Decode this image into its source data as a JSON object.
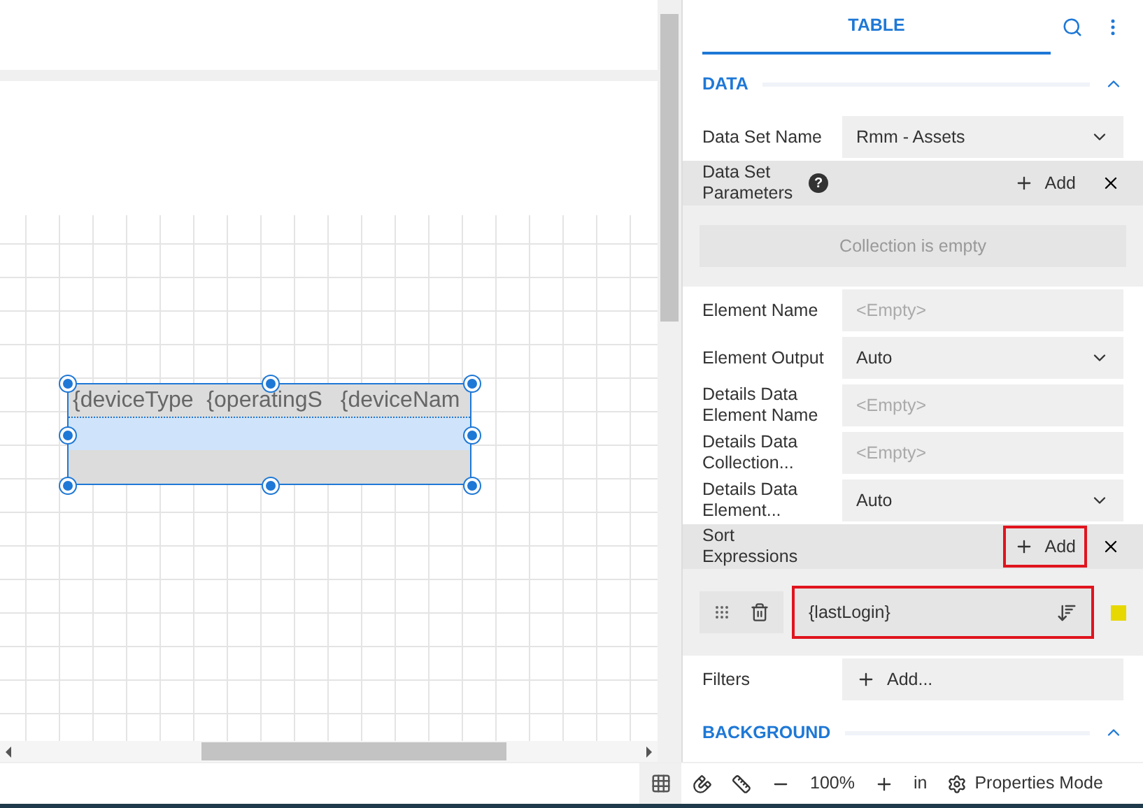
{
  "canvas": {
    "table_element": {
      "header_cells": [
        "{deviceType",
        "{operatingS",
        "{deviceNam"
      ],
      "selected": true
    }
  },
  "panel": {
    "tabs": [
      {
        "label": "TABLE",
        "selected": true
      }
    ],
    "sections": [
      {
        "title": "DATA",
        "expanded": true,
        "rows": [
          {
            "kind": "select",
            "label": "Data Set Name",
            "value": "Rmm - Assets"
          },
          {
            "kind": "collection",
            "label": "Data Set Parameters",
            "help": "?",
            "add_label": "Add",
            "highlighted": false,
            "empty_text": "Collection is empty"
          },
          {
            "kind": "text",
            "label": "Element Name",
            "placeholder": "<Empty>"
          },
          {
            "kind": "select",
            "label": "Element Output",
            "value": "Auto"
          },
          {
            "kind": "text",
            "label": "Details Data Element Name",
            "placeholder": "<Empty>"
          },
          {
            "kind": "text",
            "label": "Details Data Collection...",
            "placeholder": "<Empty>"
          },
          {
            "kind": "select",
            "label": "Details Data Element...",
            "value": "Auto"
          },
          {
            "kind": "collection",
            "label": "Sort Expressions",
            "add_label": "Add",
            "highlighted": true,
            "items": [
              {
                "value": "{lastLogin}",
                "highlighted": true,
                "color": "#e6d800"
              }
            ]
          },
          {
            "kind": "add",
            "label": "Filters",
            "add_label": "Add..."
          }
        ]
      },
      {
        "title": "BACKGROUND",
        "expanded": true
      }
    ]
  },
  "status_bar": {
    "zoom": "100%",
    "unit": "in",
    "mode": "Properties Mode"
  }
}
